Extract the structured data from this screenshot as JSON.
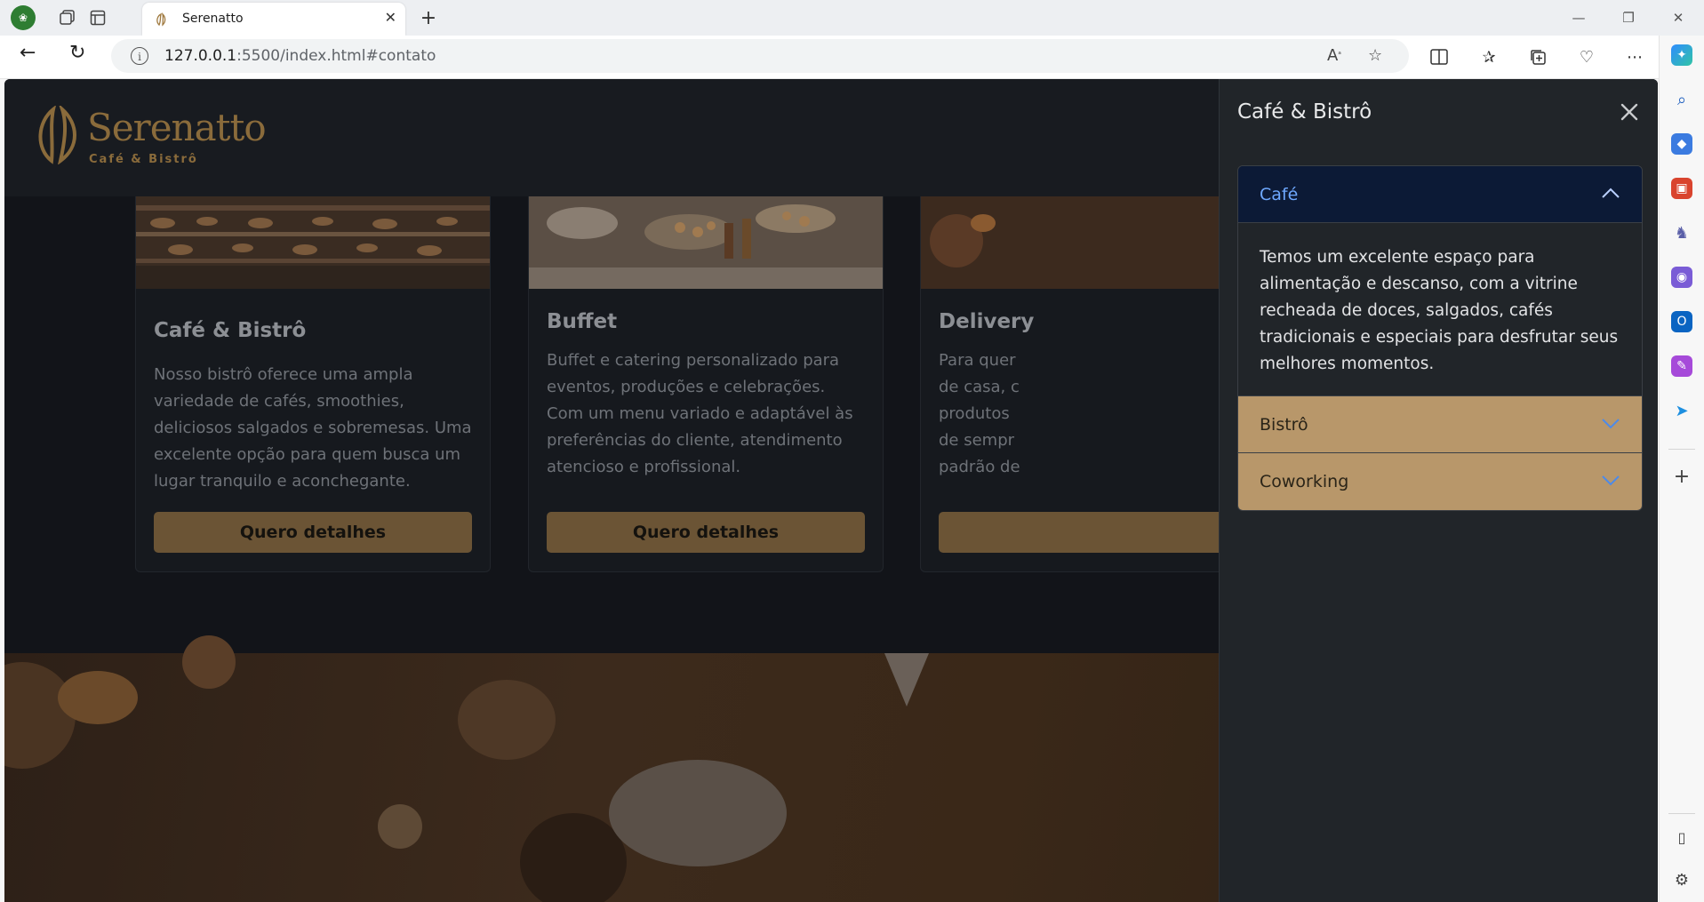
{
  "browser": {
    "tab_title": "Serenatto",
    "url_host": "127.0.0.1",
    "url_rest": ":5500/index.html#contato"
  },
  "site": {
    "brand": "Serenatto",
    "brand_sub": "Café & Bistrô"
  },
  "cards": [
    {
      "title": "Café & Bistrô",
      "text": "Nosso bistrô oferece uma ampla variedade de cafés, smoothies, deliciosos salgados e sobremesas. Uma excelente opção para quem busca um lugar tranquilo e aconchegante.",
      "cta": "Quero detalhes"
    },
    {
      "title": "Buffet",
      "text": "Buffet e catering personalizado para eventos, produções e celebrações. Com um menu variado e adaptável às preferências do cliente, atendimento atencioso e profissional.",
      "cta": "Quero detalhes"
    },
    {
      "title": "Delivery",
      "lines": [
        "Para quer",
        "de casa, c",
        "produtos",
        "de sempr",
        "padrão de"
      ],
      "cta": ""
    }
  ],
  "offcanvas": {
    "title": "Café & Bistrô",
    "accordion": [
      {
        "label": "Café",
        "expanded": true,
        "body": "Temos um excelente espaço para alimentação e descanso, com a vitrine recheada de doces, salgados, cafés tradicionais e especiais para desfrutar seus melhores momentos."
      },
      {
        "label": "Bistrô",
        "expanded": false
      },
      {
        "label": "Coworking",
        "expanded": false
      }
    ]
  },
  "colors": {
    "accent_gold": "#b8976a",
    "accordion_open_bg": "#0c1a36",
    "accordion_open_text": "#6ea8fe"
  }
}
